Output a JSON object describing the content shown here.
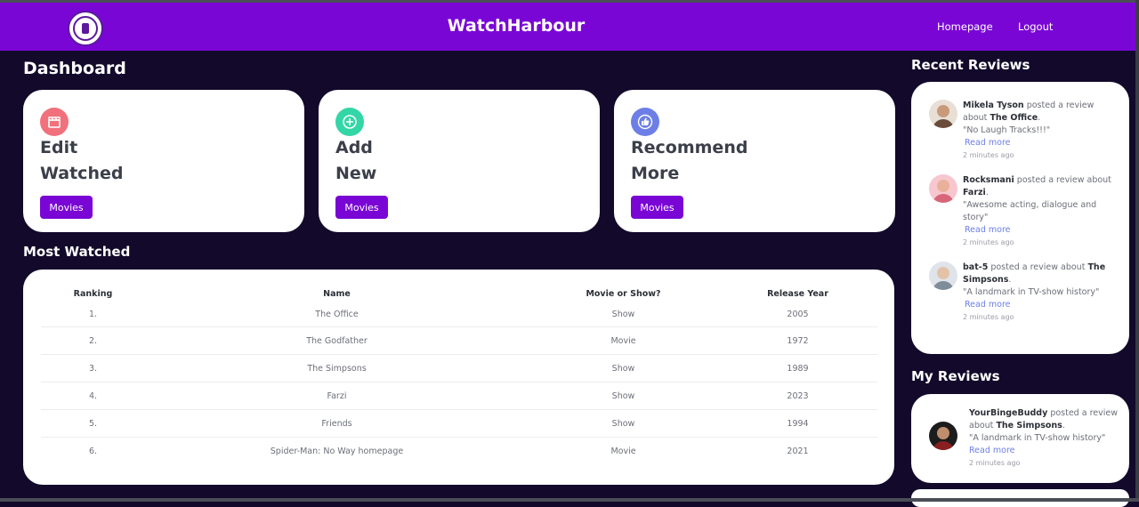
{
  "header": {
    "brand": "WatchHarbour",
    "nav": {
      "home": "Homepage",
      "logout": "Logout"
    }
  },
  "dashboard": {
    "title": "Dashboard",
    "cards": [
      {
        "line1": "Edit",
        "line2": "Watched",
        "button": "Movies",
        "icon": "clapperboard-icon",
        "color": "#f0717c"
      },
      {
        "line1": "Add",
        "line2": "New",
        "button": "Movies",
        "icon": "plus-circle-icon",
        "color": "#33d6a6"
      },
      {
        "line1": "Recommend",
        "line2": "More",
        "button": "Movies",
        "icon": "thumbs-up-icon",
        "color": "#6d7fe6"
      }
    ]
  },
  "most_watched": {
    "title": "Most Watched",
    "columns": [
      "Ranking",
      "Name",
      "Movie or Show?",
      "Release Year"
    ],
    "rows": [
      [
        "1.",
        "The Office",
        "Show",
        "2005"
      ],
      [
        "2.",
        "The Godfather",
        "Movie",
        "1972"
      ],
      [
        "3.",
        "The Simpsons",
        "Show",
        "1989"
      ],
      [
        "4.",
        "Farzi",
        "Show",
        "2023"
      ],
      [
        "5.",
        "Friends",
        "Show",
        "1994"
      ],
      [
        "6.",
        "Spider-Man: No Way homepage",
        "Movie",
        "2021"
      ]
    ]
  },
  "recent_reviews": {
    "title": "Recent Reviews",
    "items": [
      {
        "user": "Mikela Tyson",
        "verb": " posted a review about ",
        "title": "The Office",
        "quote": "\"No Laugh Tracks!!!\"",
        "read_more": "Read more",
        "time": "2 minutes ago"
      },
      {
        "user": "Rocksmani",
        "verb": " posted a review about ",
        "title": "Farzi",
        "quote": "\"Awesome acting, dialogue and story\"",
        "read_more": "Read more",
        "time": "2 minutes ago"
      },
      {
        "user": "bat-5",
        "verb": " posted a review about ",
        "title": "The Simpsons",
        "quote": "\"A landmark in TV-show history\"",
        "read_more": "Read more",
        "time": "2 minutes ago"
      }
    ]
  },
  "my_reviews": {
    "title": "My Reviews",
    "items": [
      {
        "user": "YourBingeBuddy",
        "verb": " posted a review about ",
        "title": "The Simpsons",
        "quote": "\"A landmark in TV-show history\"",
        "read_more": "Read more",
        "time": "2 minutes ago"
      }
    ]
  },
  "colors": {
    "background": "#12092b",
    "brand": "#7a06d6",
    "link": "#6d7fe6"
  }
}
